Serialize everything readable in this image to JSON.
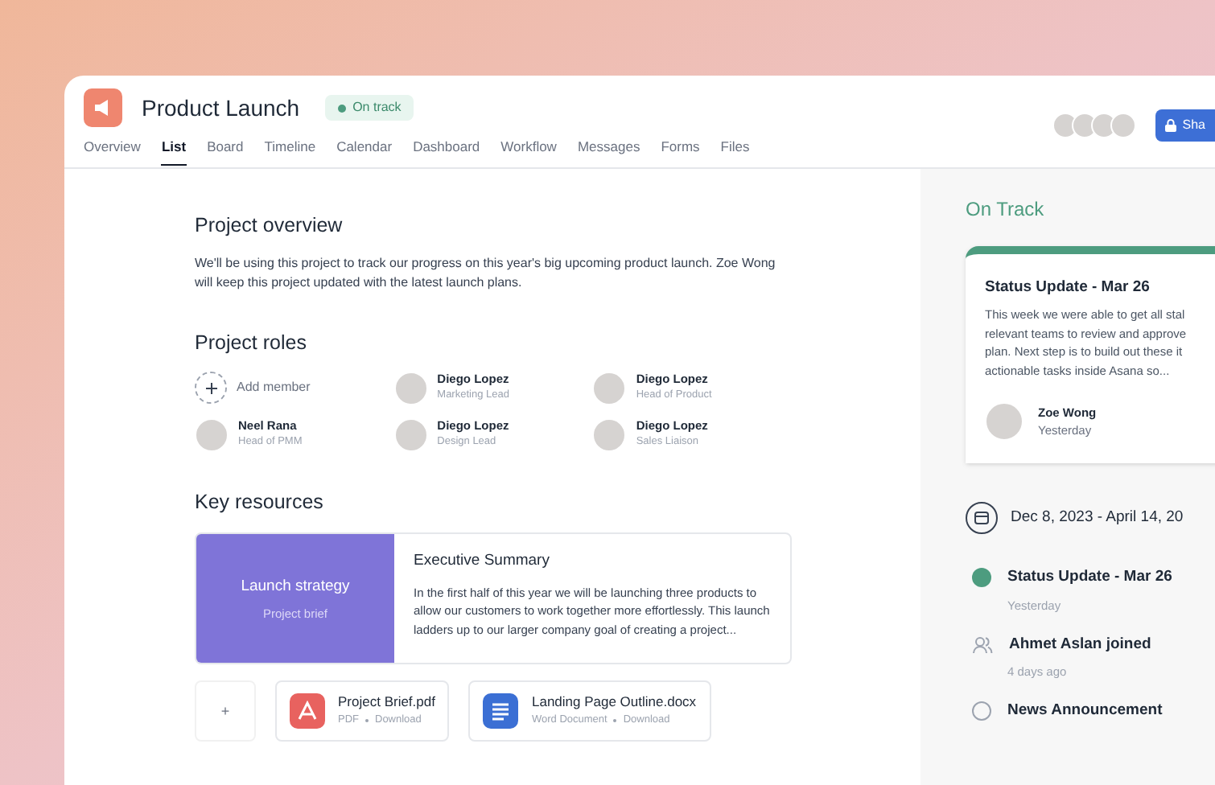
{
  "project": {
    "title": "Product Launch",
    "status": "On track"
  },
  "tabs": [
    {
      "label": "Overview",
      "selected": false
    },
    {
      "label": "List",
      "selected": true
    },
    {
      "label": "Board",
      "selected": false
    },
    {
      "label": "Timeline",
      "selected": false
    },
    {
      "label": "Calendar",
      "selected": false
    },
    {
      "label": "Dashboard",
      "selected": false
    },
    {
      "label": "Workflow",
      "selected": false
    },
    {
      "label": "Messages",
      "selected": false
    },
    {
      "label": "Forms",
      "selected": false
    },
    {
      "label": "Files",
      "selected": false
    }
  ],
  "share_button": "Sha",
  "overview": {
    "heading": "Project overview",
    "text": "We'll be using this project to track our progress on this year's big upcoming product launch. Zoe Wong will keep this project updated with the latest launch plans."
  },
  "roles": {
    "heading": "Project roles",
    "add_member": "Add member",
    "members": [
      {
        "name": "Diego Lopez",
        "role": "Marketing Lead"
      },
      {
        "name": "Diego Lopez",
        "role": "Head of Product"
      },
      {
        "name": "Neel Rana",
        "role": "Head of PMM"
      },
      {
        "name": "Diego Lopez",
        "role": "Design Lead"
      },
      {
        "name": "Diego Lopez",
        "role": "Sales Liaison"
      }
    ]
  },
  "resources": {
    "heading": "Key resources",
    "brief": {
      "title": "Launch strategy",
      "subtitle": "Project brief"
    },
    "summary": {
      "title": "Executive Summary",
      "text": "In the first half of this year we will be launching three products to allow our customers to work together more effortlessly. This launch ladders up to our larger company goal of creating a project..."
    },
    "add": "+",
    "files": [
      {
        "kind": "pdf",
        "name": "Project Brief.pdf",
        "type": "PDF",
        "action": "Download"
      },
      {
        "kind": "doc",
        "name": "Landing Page Outline.docx",
        "type": "Word Document",
        "action": "Download"
      }
    ]
  },
  "status_panel": {
    "heading": "On Track",
    "card": {
      "title": "Status Update - Mar 26",
      "lines": [
        "This week we were able to get all stal",
        "relevant teams to review and approve",
        "plan. Next step is to build out these it",
        "actionable tasks inside Asana so..."
      ],
      "author": "Zoe Wong",
      "time": "Yesterday"
    },
    "date_range": "Dec 8, 2023 - April 14, 20",
    "timeline": [
      {
        "kind": "status",
        "title": "Status Update - Mar 26",
        "time": "Yesterday"
      },
      {
        "kind": "joined",
        "title": "Ahmet Aslan joined",
        "time": "4 days ago"
      },
      {
        "kind": "announcement",
        "title": "News Announcement"
      }
    ]
  }
}
